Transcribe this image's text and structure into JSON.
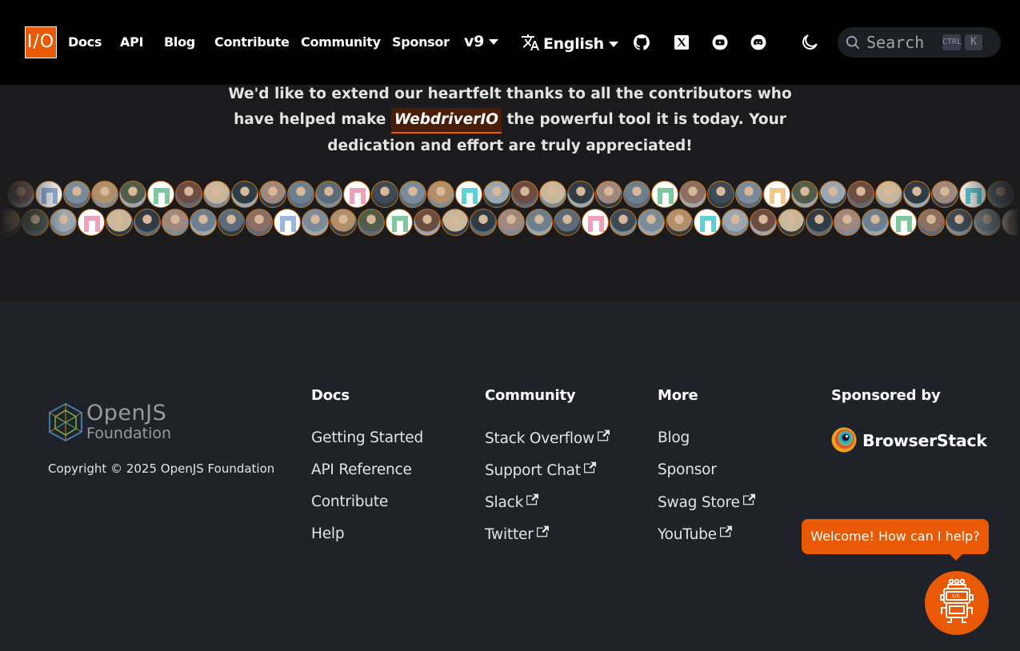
{
  "navbar": {
    "logo_text": "I/O",
    "links": [
      "Docs",
      "API",
      "Blog",
      "Contribute",
      "Community",
      "Sponsor"
    ],
    "version": "v9",
    "language": "English",
    "social_icons": [
      "github-icon",
      "x-icon",
      "youtube-icon",
      "discord-icon"
    ],
    "theme_icon": "moon-icon",
    "search": {
      "placeholder": "Search",
      "kbd_ctrl": "CTRL",
      "kbd_k": "K"
    }
  },
  "thanks": {
    "before": "We'd like to extend our heartfelt thanks to all the contributors who have helped make",
    "brand": "WebdriverIO",
    "after": "the powerful tool it is today. Your dedication and effort are truly appreciated!"
  },
  "footer": {
    "brand": {
      "name": "OpenJS",
      "sub": "Foundation"
    },
    "copyright": "Copyright © 2025 OpenJS Foundation",
    "columns": [
      {
        "title": "Docs",
        "links": [
          {
            "label": "Getting Started",
            "external": false
          },
          {
            "label": "API Reference",
            "external": false
          },
          {
            "label": "Contribute",
            "external": false
          },
          {
            "label": "Help",
            "external": false
          }
        ]
      },
      {
        "title": "Community",
        "links": [
          {
            "label": "Stack Overflow",
            "external": true
          },
          {
            "label": "Support Chat",
            "external": true
          },
          {
            "label": "Slack",
            "external": true
          },
          {
            "label": "Twitter",
            "external": true
          }
        ]
      },
      {
        "title": "More",
        "links": [
          {
            "label": "Blog",
            "external": false
          },
          {
            "label": "Sponsor",
            "external": false
          },
          {
            "label": "Swag Store",
            "external": true
          },
          {
            "label": "YouTube",
            "external": true
          }
        ]
      }
    ],
    "sponsored": {
      "title": "Sponsored by",
      "sponsor": "BrowserStack"
    }
  },
  "chat": {
    "message": "Welcome! How can I help?"
  },
  "colors": {
    "accent": "#ea5906",
    "navbar_bg": "#000000",
    "page_bg": "#1b1b1d",
    "footer_bg": "#202229"
  }
}
